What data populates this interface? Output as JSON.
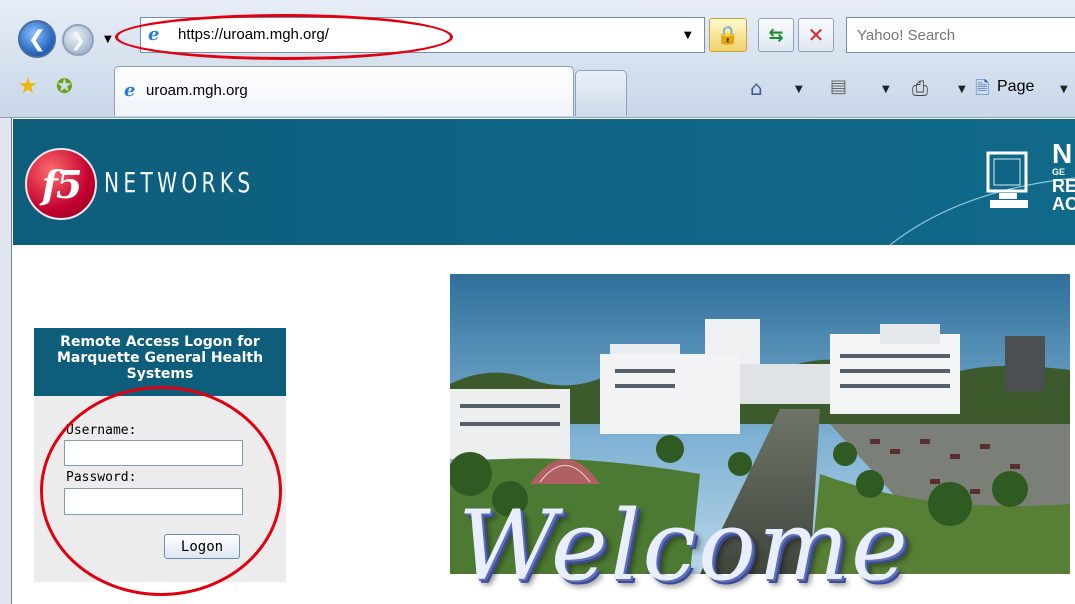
{
  "browser": {
    "address_url": "https://uroam.mgh.org/",
    "search_placeholder": "Yahoo! Search",
    "tab_title": "uroam.mgh.org",
    "page_menu_label": "Page",
    "icons": {
      "back": "back-arrow-icon",
      "forward": "forward-arrow-icon",
      "lock": "padlock-icon",
      "refresh": "refresh-icon",
      "stop": "stop-x-icon",
      "favorites": "favorites-star-icon",
      "add_favorite": "add-favorites-icon",
      "home": "home-icon",
      "feeds": "rss-feed-icon",
      "print": "printer-icon",
      "page": "page-icon"
    }
  },
  "banner": {
    "logo_text": "f5",
    "brand_text": "NETWORKS",
    "right_text_line1": "N",
    "right_text_line2": "GE",
    "right_text_line3": "RE",
    "right_text_line4": "AC"
  },
  "login": {
    "title": "Remote Access Logon for Marquette General Health Systems",
    "username_label": "Username:",
    "username_value": "",
    "password_label": "Password:",
    "password_value": "",
    "logon_button": "Logon"
  },
  "welcome": {
    "text": "Welcome"
  },
  "colors": {
    "banner": "#0f6586",
    "annotation_red": "#e1000f",
    "login_panel": "#ececec"
  }
}
